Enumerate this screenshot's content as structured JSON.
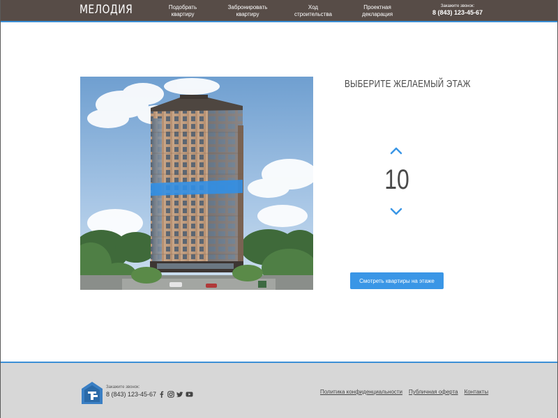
{
  "header": {
    "logo": "МЕЛОДИЯ",
    "nav": [
      {
        "line1": "Подобрать",
        "line2": "квартиру"
      },
      {
        "line1": "Забронировать",
        "line2": "квартиру"
      },
      {
        "line1": "Ход",
        "line2": "строительства"
      },
      {
        "line1": "Проектная",
        "line2": "декларация"
      }
    ],
    "phone_label": "Закажите звонок:",
    "phone": "8 (843) 123-45-67"
  },
  "main": {
    "title": "ВЫБЕРИТЕ ЖЕЛАЕМЫЙ ЭТАЖ",
    "floor": "10",
    "button_label": "Смотреть квартиры на этаже",
    "highlight_color": "#2f8fe8"
  },
  "footer": {
    "phone_label": "Закажите звонок:",
    "phone": "8 (843) 123-45-67",
    "socials": [
      "facebook-icon",
      "instagram-icon",
      "twitter-icon",
      "youtube-icon"
    ],
    "links": [
      "Политика конфиденциальности",
      "Публичная оферта",
      "Контакты"
    ]
  },
  "colors": {
    "header_bg": "#574c47",
    "accent": "#3a96e6",
    "footer_bg": "#d7d7d7"
  }
}
